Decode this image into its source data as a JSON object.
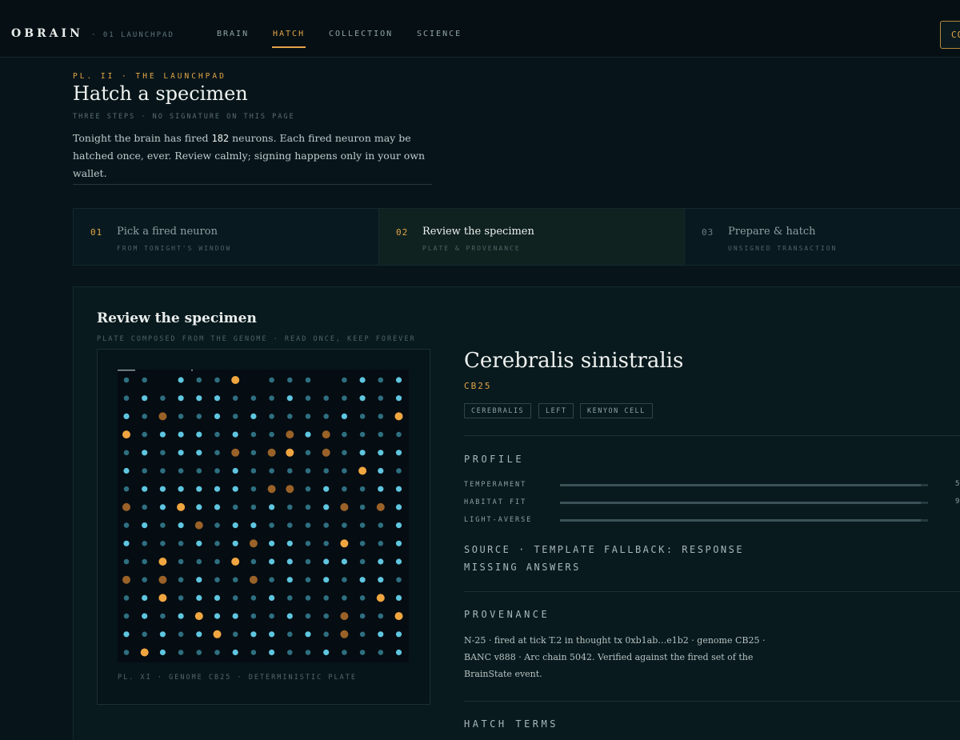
{
  "brand": {
    "name": "OBRAIN",
    "section": "· 01 LAUNCHPAD"
  },
  "nav": {
    "items": [
      {
        "label": "BRAIN"
      },
      {
        "label": "HATCH"
      },
      {
        "label": "COLLECTION"
      },
      {
        "label": "SCIENCE"
      }
    ],
    "active": "HATCH",
    "connect_label": "CO"
  },
  "header": {
    "eyebrow": "PL. II · THE LAUNCHPAD",
    "title": "Hatch a specimen",
    "subtitle": "THREE STEPS · NO SIGNATURE ON THIS PAGE",
    "intro_before": "Tonight the brain has fired ",
    "fired_count": "182",
    "intro_after": " neurons. Each fired neuron may be hatched once, ever. Review calmly; signing happens only in your own wallet."
  },
  "steps": [
    {
      "num": "01",
      "title": "Pick a fired neuron",
      "sub": "FROM TONIGHT'S WINDOW",
      "state": "done"
    },
    {
      "num": "02",
      "title": "Review the specimen",
      "sub": "PLATE & PROVENANCE",
      "state": "current"
    },
    {
      "num": "03",
      "title": "Prepare & hatch",
      "sub": "UNSIGNED TRANSACTION",
      "state": "upcoming"
    }
  ],
  "review": {
    "title": "Review the specimen",
    "subtitle": "PLATE COMPOSED FROM THE GENOME · READ ONCE, KEEP FOREVER",
    "plate_caption": "PL. XI · GENOME CB25 · DETERMINISTIC PLATE"
  },
  "specimen": {
    "name": "Cerebralis sinistralis",
    "code": "CB25",
    "tags": [
      "CEREBRALIS",
      "LEFT",
      "KENYON CELL"
    ]
  },
  "profile": {
    "heading": "PROFILE",
    "traits": [
      {
        "label": "TEMPERAMENT",
        "value": "5",
        "fraction": 0.98
      },
      {
        "label": "HABITAT FIT",
        "value": "9",
        "fraction": 0.98
      },
      {
        "label": "LIGHT-AVERSE",
        "value": "",
        "fraction": 0.98
      }
    ],
    "source_note": "SOURCE · TEMPLATE FALLBACK: RESPONSE MISSING ANSWERS"
  },
  "provenance": {
    "heading": "PROVENANCE",
    "text": "N-25 · fired at tick T.2 in thought tx 0xb1ab…e1b2 · genome CB25 · BANC v888 · Arc chain 5042. Verified against the fired set of the BrainState event."
  },
  "hatch_terms": {
    "heading": "HATCH TERMS"
  },
  "colors": {
    "accent": "#e3a548",
    "dot_cyan": "#5fc6e0",
    "dot_teal": "#2e6f80",
    "dot_amber_bright": "#f0a640",
    "dot_amber_dim": "#9a6228",
    "background": "#07151a"
  },
  "plate_grid": {
    "cols": 16,
    "rows": 16,
    "legend": "c = bright cyan, t = dim teal, a = bright amber, d = dim amber, . = empty",
    "cells": [
      "tt.ctta.ttt.tctc",
      "tctccctttctttctc",
      "ctdttctcttttcttra",
      "atccctcttdcdtttt",
      "tctcctdtdatdtccc",
      "ctttttcttttttact",
      "tcccccctddtcttcc",
      "dtcaccttcttcdtdct",
      "tctcdtcctttttttc",
      "ctttctcdccttattc",
      "ttatttatcctcctcc",
      "dtdtcttdtctctcct",
      "tcatccttctttttact",
      "tctcaccttcttdtta",
      "ctctcatcctctdtcc",
      "tactttctcttctttc"
    ]
  }
}
